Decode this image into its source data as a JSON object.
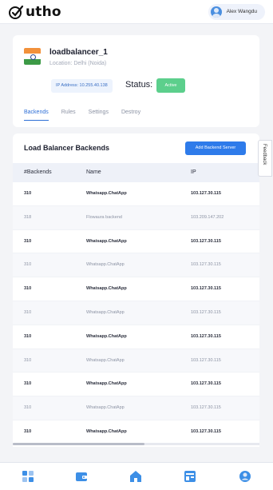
{
  "header": {
    "logo_text": "utho",
    "user_name": "Alex Wangdu"
  },
  "loadbalancer": {
    "name": "loadbalancer_1",
    "location": "Location: Delhi (Noida)",
    "ip_address": "IP Address: 10.255.40.138",
    "status_label": "Status:",
    "status_value": "Active",
    "status_color": "#5ccf8c",
    "flag_icon": "india-flag-icon"
  },
  "tabs": [
    {
      "label": "Backends",
      "active": true
    },
    {
      "label": "Rules",
      "active": false
    },
    {
      "label": "Settings",
      "active": false
    },
    {
      "label": "Destroy",
      "active": false
    }
  ],
  "backends": {
    "title": "Load Balancer Backends",
    "add_button_label": "Add Backend Server",
    "columns": [
      "#Backends",
      "Name",
      "IP"
    ],
    "rows": [
      {
        "id": "310",
        "name": "Whatsapp.ChatApp",
        "ip": "103.127.30.115"
      },
      {
        "id": "318",
        "name": "Flowaura backend",
        "ip": "103.209.147.202"
      },
      {
        "id": "310",
        "name": "Whatsapp.ChatApp",
        "ip": "103.127.30.115"
      },
      {
        "id": "310",
        "name": "Whatsapp.ChatApp",
        "ip": "103.127.30.115"
      },
      {
        "id": "310",
        "name": "Whatsapp.ChatApp",
        "ip": "103.127.30.115"
      },
      {
        "id": "310",
        "name": "Whatsapp.ChatApp",
        "ip": "103.127.30.115"
      },
      {
        "id": "310",
        "name": "Whatsapp.ChatApp",
        "ip": "103.127.30.115"
      },
      {
        "id": "310",
        "name": "Whatsapp.ChatApp",
        "ip": "103.127.30.115"
      },
      {
        "id": "310",
        "name": "Whatsapp.ChatApp",
        "ip": "103.127.30.115"
      },
      {
        "id": "310",
        "name": "Whatsapp.ChatApp",
        "ip": "103.127.30.115"
      },
      {
        "id": "310",
        "name": "Whatsapp.ChatApp",
        "ip": "103.127.30.115"
      }
    ]
  },
  "feedback_label": "Feedback",
  "bottom_nav": [
    {
      "icon": "dashboard-icon"
    },
    {
      "icon": "wallet-icon"
    },
    {
      "icon": "home-icon"
    },
    {
      "icon": "layout-icon"
    },
    {
      "icon": "profile-icon"
    }
  ],
  "colors": {
    "accent": "#2e7bea",
    "nav_icon": "#3d8fe6"
  }
}
